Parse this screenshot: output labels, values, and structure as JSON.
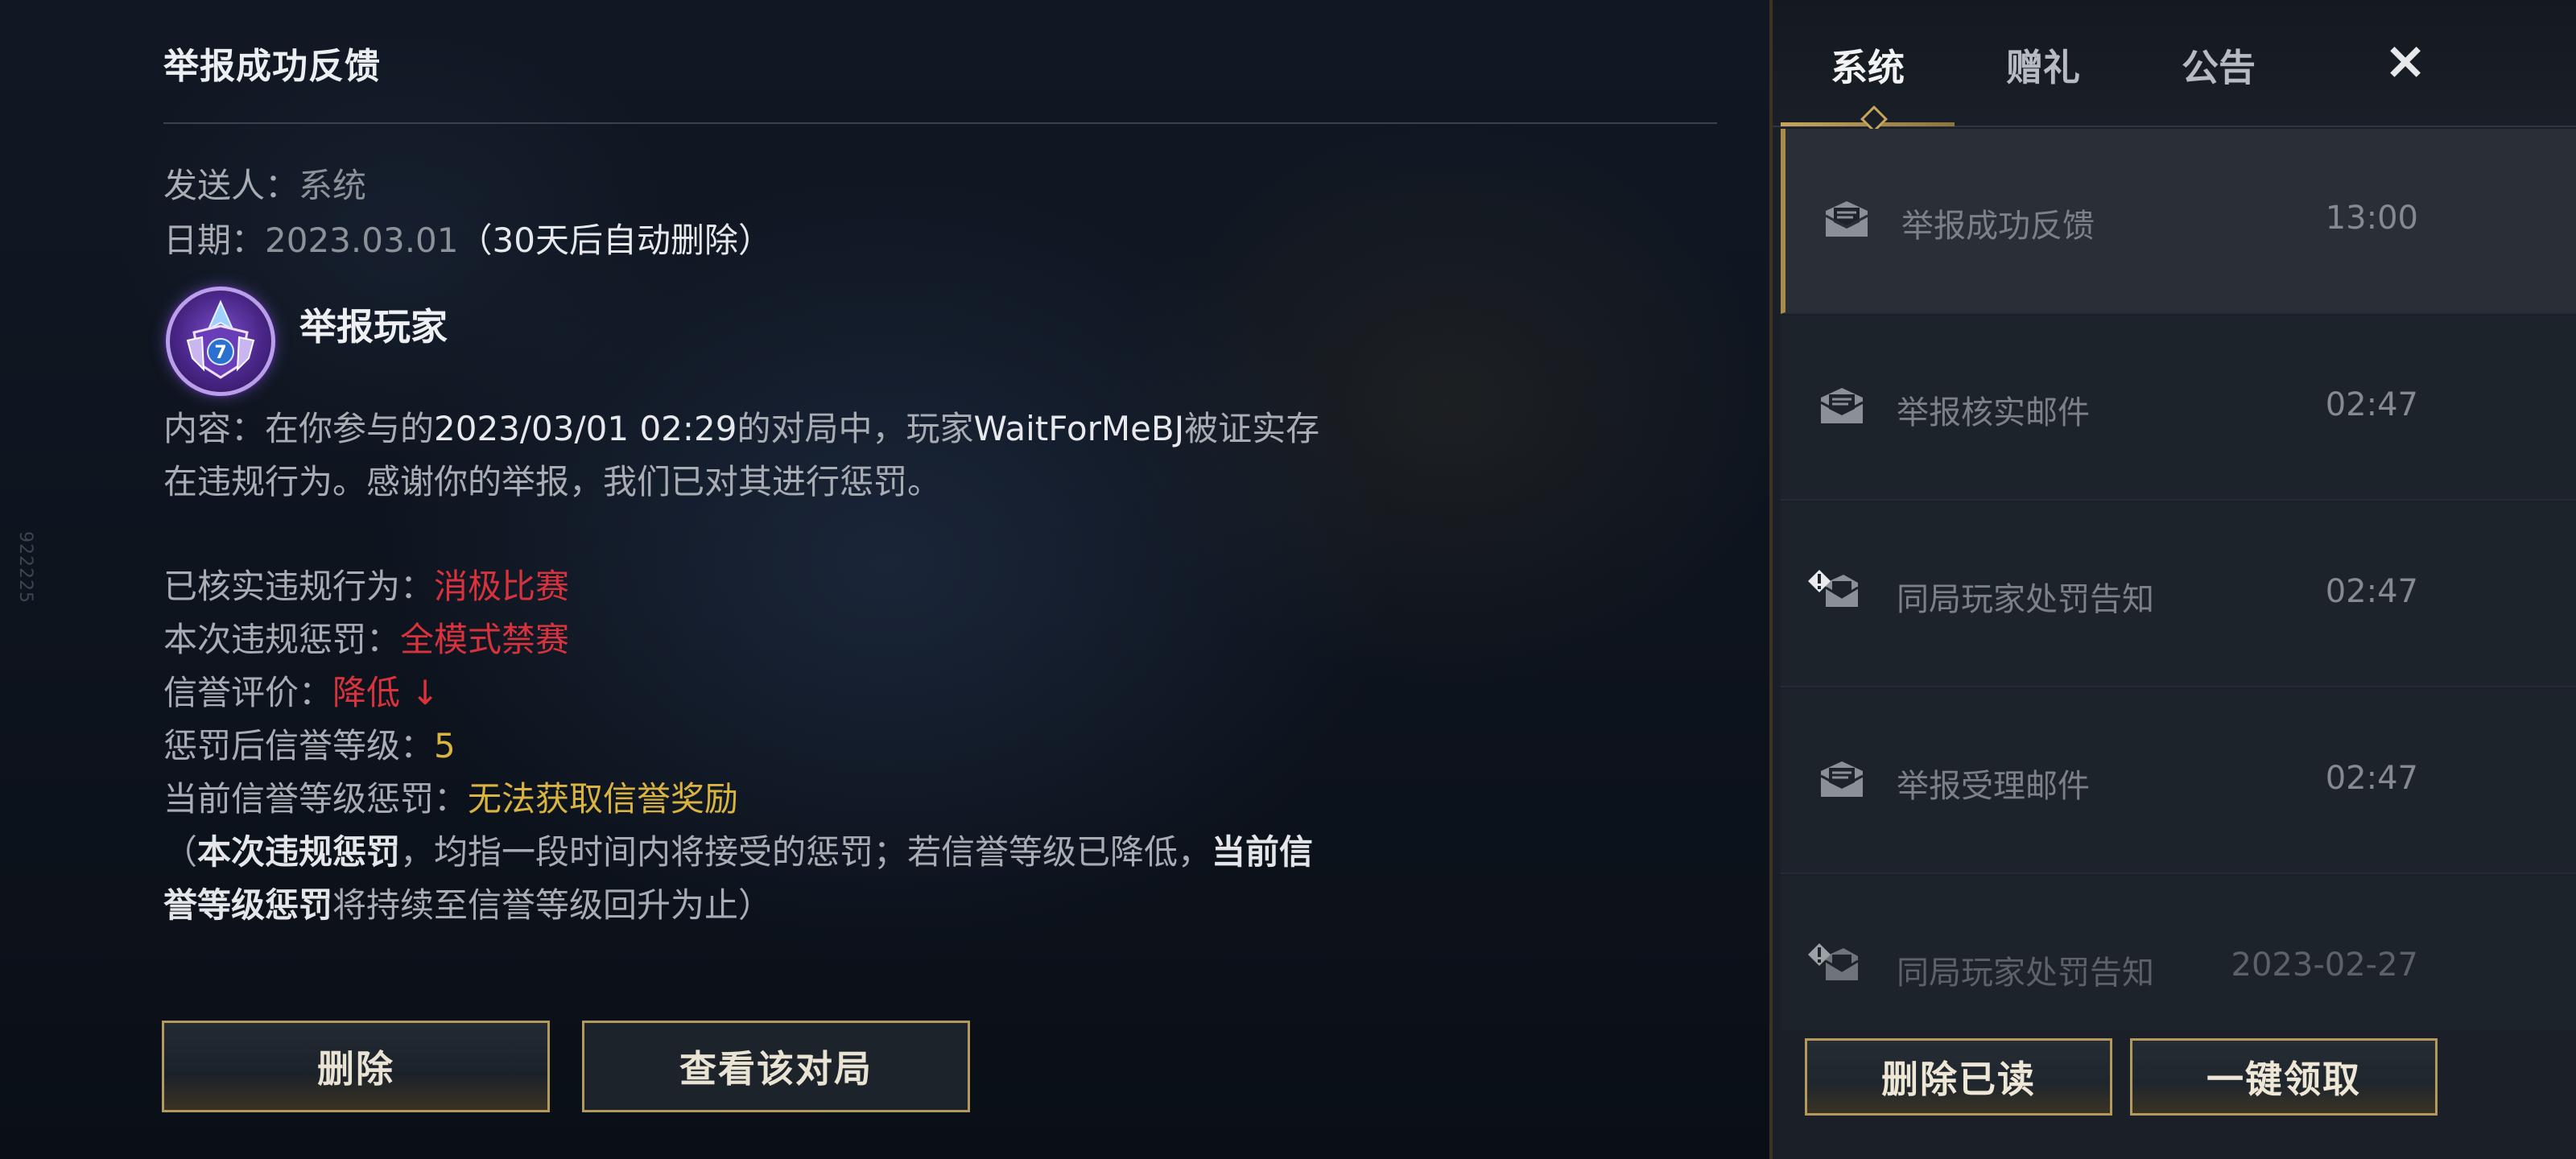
{
  "side_id": "922225",
  "detail": {
    "title": "举报成功反馈",
    "sender_label": "发送人：",
    "sender_value": "系统",
    "date_label": "日期：",
    "date_value": "2023.03.01",
    "date_note": "（30天后自动删除）",
    "report_title": "举报玩家",
    "content_line1_prefix": "内容：在你参与的",
    "content_line1_time": "2023/03/01 02:29",
    "content_line1_mid": "的对局中，玩家",
    "content_line1_player": "WaitForMeBJ",
    "content_line1_suffix": "被证实存",
    "content_line2": "在违规行为。感谢你的举报，我们已对其进行惩罚。",
    "verified_label": "已核实违规行为：",
    "verified_value": "消极比赛",
    "penalty_label": "本次违规惩罚：",
    "penalty_value": "全模式禁赛",
    "credit_label": "信誉评价：",
    "credit_value": "降低 ↓",
    "level_label": "惩罚后信誉等级：",
    "level_value": "5",
    "current_label": "当前信誉等级惩罚：",
    "current_value": "无法获取信誉奖励",
    "note_line1_open": "（",
    "note_line1_bold1": "本次违规惩罚",
    "note_line1_mid": "，均指一段时间内将接受的惩罚；若信誉等级已降低，",
    "note_line1_bold2": "当前信",
    "note_line2_bold": "誉等级惩罚",
    "note_line2_rest": "将持续至信誉等级回升为止）",
    "delete_button": "删除",
    "view_match_button": "查看该对局"
  },
  "panel": {
    "tabs": [
      {
        "label": "系统",
        "active": true
      },
      {
        "label": "赠礼",
        "active": false
      },
      {
        "label": "公告",
        "active": false
      }
    ],
    "close_icon": "×",
    "mails": [
      {
        "label": "举报成功反馈",
        "time": "13:00",
        "icon": "mail-open-icon",
        "selected": true
      },
      {
        "label": "举报核实邮件",
        "time": "02:47",
        "icon": "mail-open-icon",
        "selected": false
      },
      {
        "label": "同局玩家处罚告知",
        "time": "02:47",
        "icon": "mail-alert-icon",
        "selected": false
      },
      {
        "label": "举报受理邮件",
        "time": "02:47",
        "icon": "mail-open-icon",
        "selected": false
      },
      {
        "label": "同局玩家处罚告知",
        "time": "2023-02-27",
        "icon": "mail-alert-icon",
        "selected": false
      }
    ],
    "delete_read_button": "删除已读",
    "claim_all_button": "一键领取"
  },
  "colors": {
    "accent_gold": "#b39a5c",
    "penalty_red": "#d8323c",
    "level_gold": "#d9b440"
  }
}
